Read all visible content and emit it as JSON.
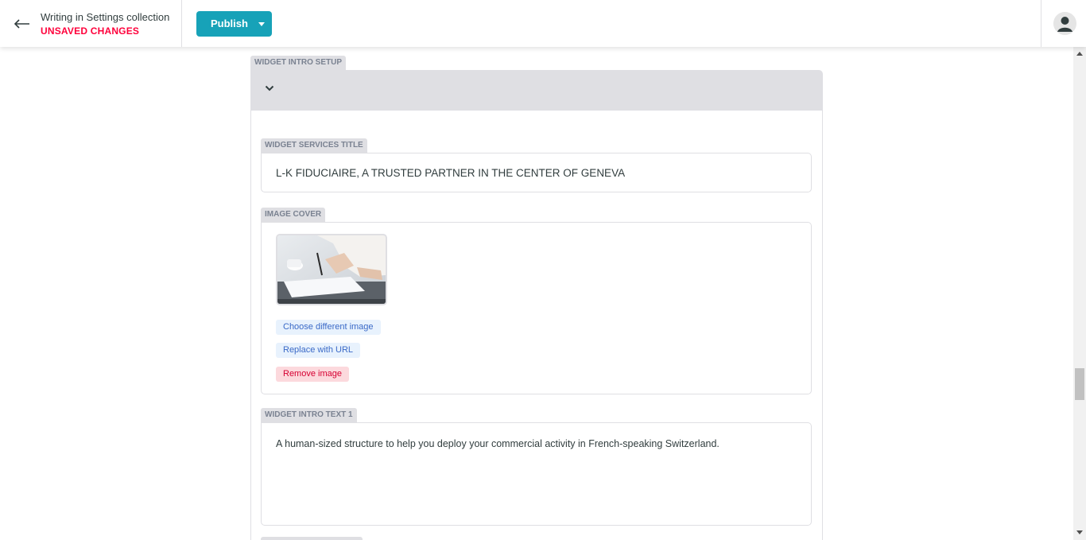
{
  "header": {
    "back_title": "Writing in Settings collection",
    "status": "UNSAVED CHANGES",
    "publish_label": "Publish"
  },
  "section": {
    "tag": "WIDGET INTRO SETUP"
  },
  "fields": {
    "services_title": {
      "label": "WIDGET SERVICES TITLE",
      "value": "L-K FIDUCIAIRE, A TRUSTED PARTNER IN THE CENTER OF GENEVA"
    },
    "image_cover": {
      "label": "IMAGE COVER",
      "choose_label": "Choose different image",
      "replace_label": "Replace with URL",
      "remove_label": "Remove image"
    },
    "intro_text_1": {
      "label": "WIDGET INTRO TEXT 1",
      "value": "A human-sized structure to help you deploy your commercial activity in French-speaking Switzerland."
    }
  },
  "colors": {
    "accent": "#17a2b8",
    "unsaved": "#ff003b",
    "label_bg": "#dfdfe3",
    "link_blue": "#3a69c7",
    "remove_red": "#d60032"
  }
}
